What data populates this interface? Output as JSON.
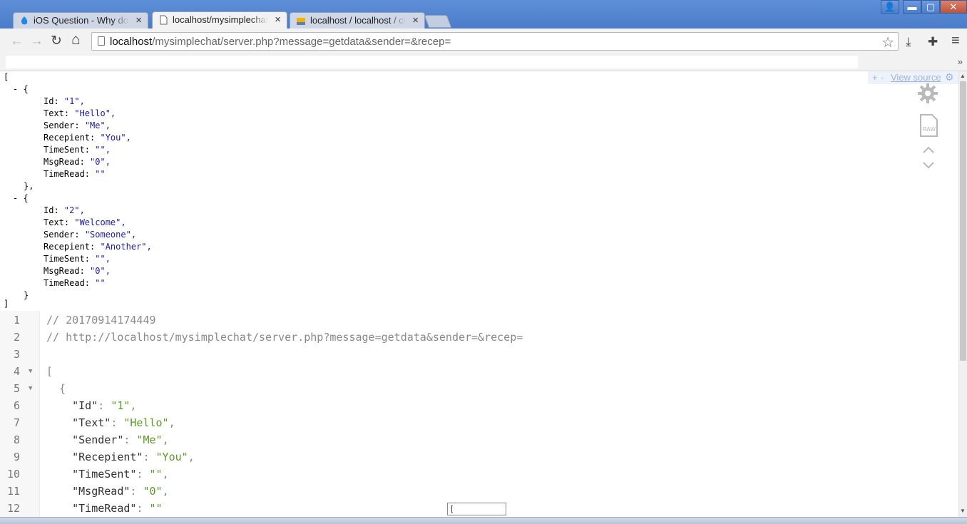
{
  "tabs": [
    {
      "label": "iOS Question - Why does I",
      "icon": "ios-tab-icon",
      "active": false
    },
    {
      "label": "localhost/mysimplechat/se",
      "icon": "page-icon",
      "active": true
    },
    {
      "label": "localhost / localhost / chat",
      "icon": "phpmyadmin-icon",
      "active": false
    }
  ],
  "window_controls": {
    "user": "👤",
    "minimize": "▬",
    "maximize": "▢",
    "close": "✕"
  },
  "toolbar": {
    "url_host": "localhost",
    "url_rest": "/mysimplechat/server.php?message=getdata&sender=&recep=",
    "back": "←",
    "forward": "→",
    "reload": "↻",
    "home": "⌂",
    "bookmark_star": "☆",
    "download_icon": "⤓",
    "extensions_icon": "✚",
    "menu_icon": "≡"
  },
  "bookmarks_more": "»",
  "json_viewer": {
    "view_source_label": "View source",
    "plus": "+",
    "minus": "-",
    "open_bracket": "[",
    "close_bracket": "]",
    "records": [
      {
        "open": "- {",
        "close": "},",
        "lines": [
          [
            "Id",
            "\"1\","
          ],
          [
            "Text",
            "\"Hello\","
          ],
          [
            "Sender",
            "\"Me\","
          ],
          [
            "Recepient",
            "\"You\","
          ],
          [
            "TimeSent",
            "\"\","
          ],
          [
            "MsgRead",
            "\"0\","
          ],
          [
            "TimeRead",
            "\"\""
          ]
        ]
      },
      {
        "open": "- {",
        "close": "}",
        "lines": [
          [
            "Id",
            "\"2\","
          ],
          [
            "Text",
            "\"Welcome\","
          ],
          [
            "Sender",
            "\"Someone\","
          ],
          [
            "Recepient",
            "\"Another\","
          ],
          [
            "TimeSent",
            "\"\","
          ],
          [
            "MsgRead",
            "\"0\","
          ],
          [
            "TimeRead",
            "\"\""
          ]
        ]
      }
    ]
  },
  "code_view": {
    "lines": [
      {
        "n": "1",
        "text": "// 20170914174449"
      },
      {
        "n": "2",
        "text": "// http://localhost/mysimplechat/server.php?message=getdata&sender=&recep="
      },
      {
        "n": "3",
        "text": ""
      },
      {
        "n": "4",
        "text": "["
      },
      {
        "n": "5",
        "text": "  {"
      },
      {
        "n": "6",
        "key": "\"Id\"",
        "val": "\"1\""
      },
      {
        "n": "7",
        "key": "\"Text\"",
        "val": "\"Hello\""
      },
      {
        "n": "8",
        "key": "\"Sender\"",
        "val": "\"Me\""
      },
      {
        "n": "9",
        "key": "\"Recepient\"",
        "val": "\"You\""
      },
      {
        "n": "10",
        "key": "\"TimeSent\"",
        "val": "\"\""
      },
      {
        "n": "11",
        "key": "\"MsgRead\"",
        "val": "\"0\""
      },
      {
        "n": "12",
        "key": "\"TimeRead\"",
        "val": "\"\""
      }
    ],
    "fold_marker": "▼"
  },
  "tooltip_text": "[",
  "colors": {
    "titlebar": "#4a7cc9",
    "json_string": "#1a1aa6",
    "code_string": "#5b9a25"
  }
}
